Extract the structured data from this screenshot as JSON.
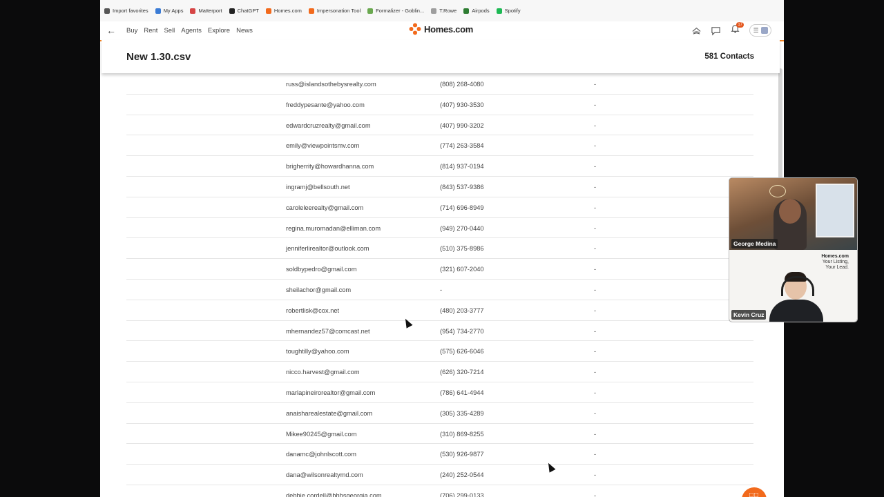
{
  "bookmarks": [
    {
      "label": "Import favorites",
      "icon": "import-icon",
      "color": "#555555"
    },
    {
      "label": "My Apps",
      "icon": "apps-grid-icon",
      "color": "#3a7bd5"
    },
    {
      "label": "Matterport",
      "icon": "matterport-icon",
      "color": "#d64545"
    },
    {
      "label": "ChatGPT",
      "icon": "chatgpt-icon",
      "color": "#222222"
    },
    {
      "label": "Homes.com",
      "icon": "homes-logo-icon",
      "color": "#f26a1c"
    },
    {
      "label": "Impersonation Tool",
      "icon": "homes-logo-icon",
      "color": "#f26a1c"
    },
    {
      "label": "Formalizer - Goblin...",
      "icon": "goblin-icon",
      "color": "#6aa84f"
    },
    {
      "label": "T.Rowe",
      "icon": "document-icon",
      "color": "#9e9e9e"
    },
    {
      "label": "Airpods",
      "icon": "airpods-icon",
      "color": "#2e7d32"
    },
    {
      "label": "Spotify",
      "icon": "spotify-icon",
      "color": "#1db954"
    }
  ],
  "nav": {
    "links": [
      "Buy",
      "Rent",
      "Sell",
      "Agents",
      "Explore",
      "News"
    ],
    "logo_text": "Homes.com",
    "notification_count": "17",
    "accent": "#f08021"
  },
  "file": {
    "title": "New 1.30.csv",
    "count": "581 Contacts"
  },
  "contacts": [
    {
      "email": "russ@islandsothebysrealty.com",
      "phone": "(808) 268-4080",
      "extra": "-"
    },
    {
      "email": "freddypesante@yahoo.com",
      "phone": "(407) 930-3530",
      "extra": "-"
    },
    {
      "email": "edwardcruzrealty@gmail.com",
      "phone": "(407) 990-3202",
      "extra": "-"
    },
    {
      "email": "emily@viewpointsmv.com",
      "phone": "(774) 263-3584",
      "extra": "-"
    },
    {
      "email": "brigherrity@howardhanna.com",
      "phone": "(814) 937-0194",
      "extra": "-"
    },
    {
      "email": "ingramj@bellsouth.net",
      "phone": "(843) 537-9386",
      "extra": "-"
    },
    {
      "email": "caroleleerealty@gmail.com",
      "phone": "(714) 696-8949",
      "extra": "-"
    },
    {
      "email": "regina.muromadan@elliman.com",
      "phone": "(949) 270-0440",
      "extra": "-"
    },
    {
      "email": "jenniferlirealtor@outlook.com",
      "phone": "(510) 375-8986",
      "extra": "-"
    },
    {
      "email": "soldbypedro@gmail.com",
      "phone": "(321) 607-2040",
      "extra": "-"
    },
    {
      "email": "sheilachor@gmail.com",
      "phone": "-",
      "extra": "-"
    },
    {
      "email": "robertlisk@cox.net",
      "phone": "(480) 203-3777",
      "extra": "-"
    },
    {
      "email": "mhernandez57@comcast.net",
      "phone": "(954) 734-2770",
      "extra": "-"
    },
    {
      "email": "toughtilly@yahoo.com",
      "phone": "(575) 626-6046",
      "extra": "-"
    },
    {
      "email": "nicco.harvest@gmail.com",
      "phone": "(626) 320-7214",
      "extra": "-"
    },
    {
      "email": "marlapineirorealtor@gmail.com",
      "phone": "(786) 641-4944",
      "extra": "-"
    },
    {
      "email": "anaisharealestate@gmail.com",
      "phone": "(305) 335-4289",
      "extra": "-"
    },
    {
      "email": "Mikee90245@gmail.com",
      "phone": "(310) 869-8255",
      "extra": "-"
    },
    {
      "email": "danamc@johnlscott.com",
      "phone": "(530) 926-9877",
      "extra": "-"
    },
    {
      "email": "dana@wilsonrealtymd.com",
      "phone": "(240) 252-0544",
      "extra": "-"
    },
    {
      "email": "debbie.cordell@bhhsgeorgia.com",
      "phone": "(706) 299-0133",
      "extra": "-"
    }
  ],
  "video": {
    "participant1": "George Medina",
    "participant2": "Kevin Cruz",
    "brand_name": "Homes.com",
    "brand_tagline_1": "Your Listing,",
    "brand_tagline_2": "Your Lead."
  }
}
